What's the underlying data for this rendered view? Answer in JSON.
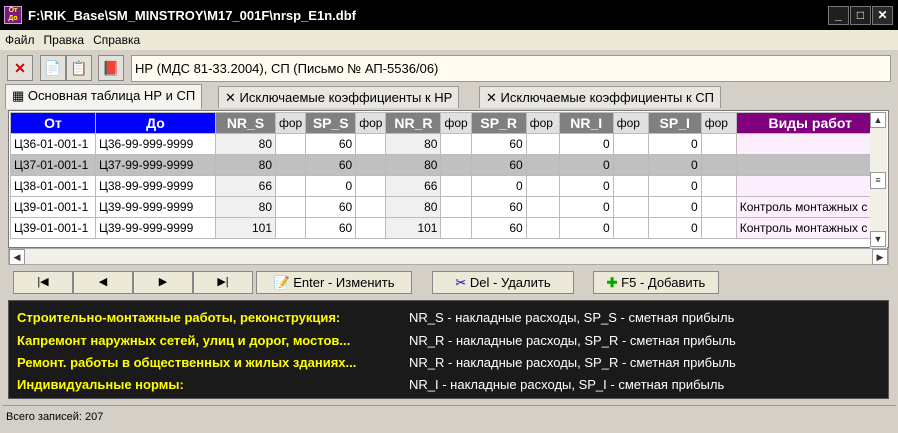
{
  "window": {
    "title": "F:\\RIK_Base\\SM_MINSTROY\\M17_001F\\nrsp_E1n.dbf",
    "icon_text": "От До"
  },
  "menu": [
    "Файл",
    "Правка",
    "Справка"
  ],
  "toolbar": {
    "title_field": "НР (МДС 81-33.2004), СП (Письмо № АП-5536/06)"
  },
  "tabs": [
    "Основная таблица НР и СП",
    "Исключаемые коэффициенты к НР",
    "Исключаемые коэффициенты к СП"
  ],
  "columns": [
    "От",
    "До",
    "NR_S",
    "фор",
    "SP_S",
    "фор",
    "NR_R",
    "фор",
    "SP_R",
    "фор",
    "NR_I",
    "фор",
    "SP_I",
    "фор",
    "Виды работ"
  ],
  "rows": [
    [
      "Ц36-01-001-1",
      "Ц36-99-999-9999",
      "80",
      "",
      "60",
      "",
      "80",
      "",
      "60",
      "",
      "0",
      "",
      "0",
      "",
      ""
    ],
    [
      "Ц37-01-001-1",
      "Ц37-99-999-9999",
      "80",
      "",
      "60",
      "",
      "80",
      "",
      "60",
      "",
      "0",
      "",
      "0",
      "",
      ""
    ],
    [
      "Ц38-01-001-1",
      "Ц38-99-999-9999",
      "66",
      "",
      "0",
      "",
      "66",
      "",
      "0",
      "",
      "0",
      "",
      "0",
      "",
      ""
    ],
    [
      "Ц39-01-001-1",
      "Ц39-99-999-9999",
      "80",
      "",
      "60",
      "",
      "80",
      "",
      "60",
      "",
      "0",
      "",
      "0",
      "",
      "Контроль монтажных с"
    ],
    [
      "Ц39-01-001-1",
      "Ц39-99-999-9999",
      "101",
      "",
      "60",
      "",
      "101",
      "",
      "60",
      "",
      "0",
      "",
      "0",
      "",
      "Контроль монтажных с"
    ]
  ],
  "selected_row": 1,
  "buttons": {
    "edit": "Enter - Изменить",
    "delete": "Del - Удалить",
    "add": "F5 - Добавить"
  },
  "legend": [
    {
      "label": "Строительно-монтажные работы, реконструкция:",
      "desc": "NR_S - накладные расходы, SP_S - сметная прибыль"
    },
    {
      "label": "Капремонт наружных сетей, улиц и дорог, мостов...",
      "desc": "NR_R - накладные расходы, SP_R - сметная прибыль"
    },
    {
      "label": "Ремонт. работы в общественных и жилых зданиях...",
      "desc": "NR_R - накладные расходы, SP_R - сметная прибыль"
    },
    {
      "label": "Индивидуальные нормы:",
      "desc": "NR_I - накладные расходы, SP_I - сметная прибыль"
    }
  ],
  "status": "Всего записей: 207"
}
